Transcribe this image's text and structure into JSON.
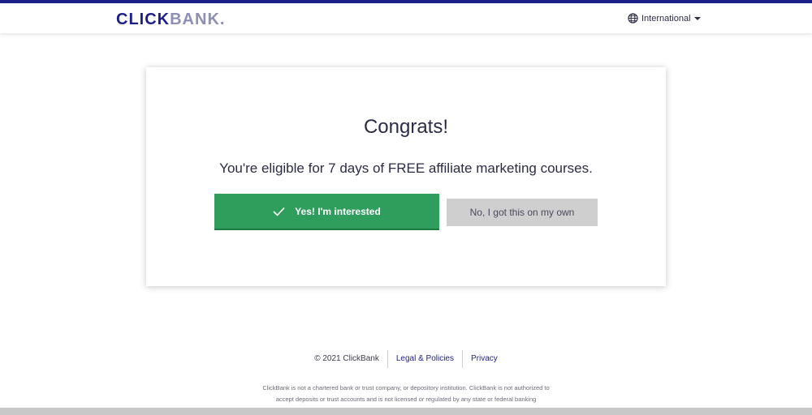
{
  "header": {
    "logo_click": "CLICK",
    "logo_bank": "BANK",
    "logo_dot": ".",
    "language_label": "International",
    "globe_icon": "globe-icon",
    "caret_icon": "caret-down-icon",
    "accent_color": "#1b1f8a"
  },
  "card": {
    "title": "Congrats!",
    "subtitle": "You're eligible for 7 days of FREE affiliate marketing courses.",
    "yes_button": "Yes! I'm interested",
    "no_button": "No, I got this on my own",
    "yes_color": "#2f9e5c",
    "no_color": "#cfcfcf"
  },
  "footer": {
    "copyright": "© 2021 ClickBank",
    "legal_link": "Legal & Policies",
    "privacy_link": "Privacy",
    "disclaimer_line1": "ClickBank is not a chartered bank or trust company, or depository institution. ClickBank is not authorized to",
    "disclaimer_line2": "accept deposits or trust accounts and is not licensed or regulated by any state or federal banking"
  }
}
